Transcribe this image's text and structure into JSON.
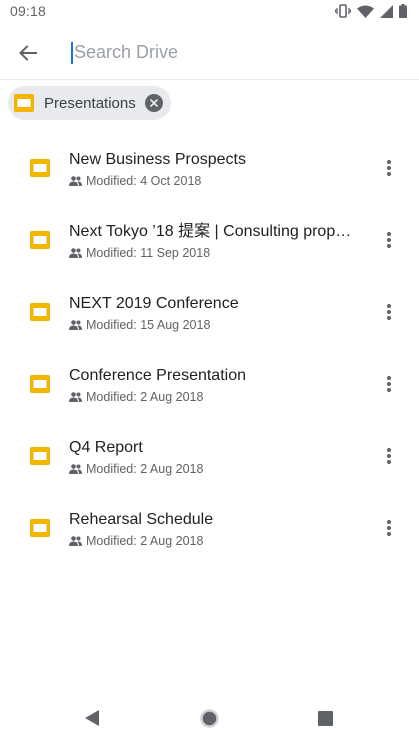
{
  "status_bar": {
    "time": "09:18",
    "icons": [
      "vibrate-icon",
      "wifi-icon",
      "signal-icon",
      "battery-icon"
    ]
  },
  "search": {
    "placeholder": "Search Drive",
    "value": ""
  },
  "filter_chip": {
    "label": "Presentations",
    "icon": "slides-icon",
    "color": "#f4b400"
  },
  "files": [
    {
      "title": "New Business Prospects",
      "modified": "Modified: 4 Oct 2018"
    },
    {
      "title": "Next Tokyo ’18 提案 | Consulting prop…",
      "modified": "Modified: 11 Sep 2018"
    },
    {
      "title": "NEXT 2019 Conference",
      "modified": "Modified: 15 Aug 2018"
    },
    {
      "title": "Conference Presentation",
      "modified": "Modified: 2 Aug 2018"
    },
    {
      "title": "Q4 Report",
      "modified": "Modified: 2 Aug 2018"
    },
    {
      "title": "Rehearsal Schedule",
      "modified": "Modified: 2 Aug 2018"
    }
  ],
  "colors": {
    "slides_yellow": "#f4b400",
    "accent_blue": "#1a73e8",
    "icon_grey": "#5f6368"
  }
}
